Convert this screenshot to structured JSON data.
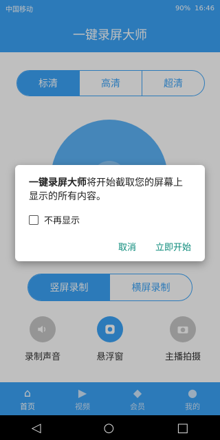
{
  "status_bar": {
    "carrier": "中国移动",
    "battery": "90%",
    "time": "16:46"
  },
  "app": {
    "title": "一键录屏大师"
  },
  "quality_tabs": [
    "标清",
    "高清",
    "超清"
  ],
  "dialog": {
    "app_name": "一键录屏大师",
    "message_rest": "将开始截取您的屏幕上显示的所有内容。",
    "checkbox_label": "不再显示",
    "cancel": "取消",
    "confirm": "立即开始"
  },
  "modes": {
    "portrait": "竖屏录制",
    "landscape": "横屏录制"
  },
  "features": [
    {
      "label": "录制声音",
      "icon": "speaker-icon"
    },
    {
      "label": "悬浮窗",
      "icon": "float-window-icon"
    },
    {
      "label": "主播拍摄",
      "icon": "camera-icon"
    }
  ],
  "bottom_tabs": [
    {
      "label": "首页",
      "icon": "home-icon"
    },
    {
      "label": "视频",
      "icon": "video-icon"
    },
    {
      "label": "会员",
      "icon": "vip-icon"
    },
    {
      "label": "我的",
      "icon": "profile-icon"
    }
  ],
  "colors": {
    "primary": "#3ba3f7",
    "dialog_action": "#0a8a7a"
  }
}
